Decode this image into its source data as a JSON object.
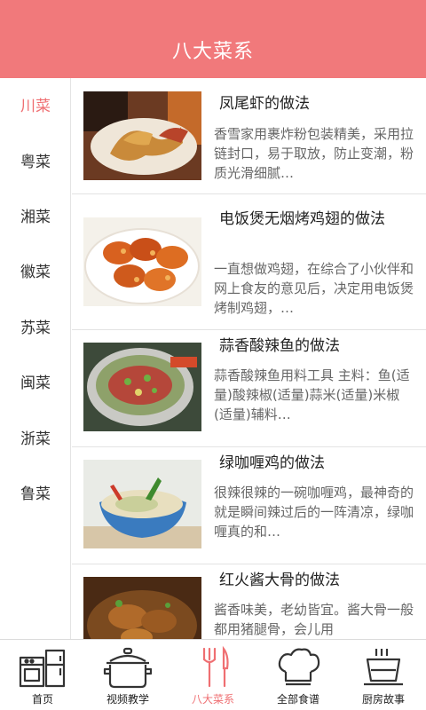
{
  "header": {
    "title": "八大菜系"
  },
  "sidebar": {
    "items": [
      {
        "label": "川菜"
      },
      {
        "label": "粤菜"
      },
      {
        "label": "湘菜"
      },
      {
        "label": "徽菜"
      },
      {
        "label": "苏菜"
      },
      {
        "label": "闽菜"
      },
      {
        "label": "浙菜"
      },
      {
        "label": "鲁菜"
      }
    ],
    "selected": "川菜"
  },
  "recipes": [
    {
      "title": "凤尾虾的做法",
      "desc": "香雪家用裹炸粉包装精美，采用拉链封口，易于取放，防止变潮，粉质光滑细腻…"
    },
    {
      "title": "电饭煲无烟烤鸡翅的做法",
      "desc": "一直想做鸡翅，在综合了小伙伴和网上食友的意见后，决定用电饭煲烤制鸡翅，…"
    },
    {
      "title": "蒜香酸辣鱼的做法",
      "desc": "蒜香酸辣鱼用料工具 主料：鱼(适量)酸辣椒(适量)蒜米(适量)米椒(适量)辅料…"
    },
    {
      "title": "绿咖喱鸡的做法",
      "desc": "很辣很辣的一碗咖喱鸡，最神奇的就是瞬间辣过后的一阵清凉，绿咖喱真的和…"
    },
    {
      "title": "红火酱大骨的做法",
      "desc": "酱香味美，老幼皆宜。酱大骨一般都用猪腿骨，会儿用"
    }
  ],
  "tabbar": {
    "items": [
      {
        "label": "首页",
        "icon": "kitchen-icon"
      },
      {
        "label": "视频教学",
        "icon": "pot-icon"
      },
      {
        "label": "八大菜系",
        "icon": "fork-knife-icon"
      },
      {
        "label": "全部食谱",
        "icon": "chef-hat-icon"
      },
      {
        "label": "厨房故事",
        "icon": "cup-icon"
      }
    ],
    "selected": "八大菜系"
  },
  "colors": {
    "accent": "#f1797b",
    "active_text": "#ef6f72"
  }
}
